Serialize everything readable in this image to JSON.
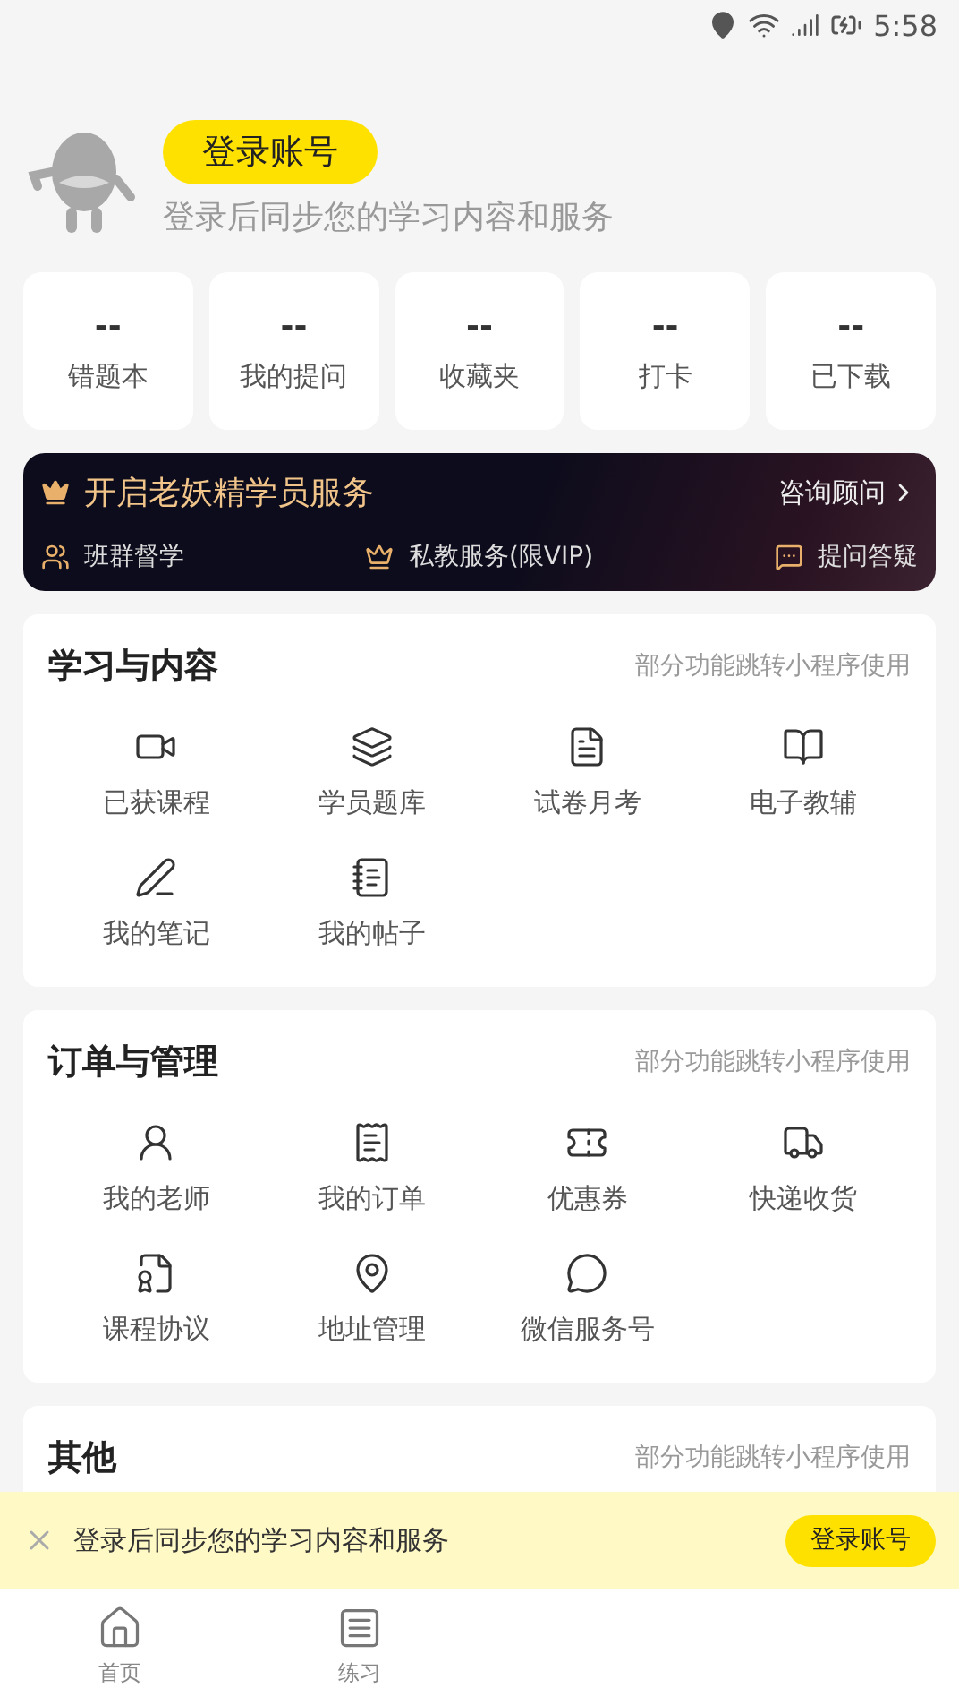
{
  "status_bar": {
    "time": "5:58"
  },
  "profile": {
    "login_button": "登录账号",
    "subtitle": "登录后同步您的学习内容和服务"
  },
  "stats": [
    {
      "value": "--",
      "label": "错题本"
    },
    {
      "value": "--",
      "label": "我的提问"
    },
    {
      "value": "--",
      "label": "收藏夹"
    },
    {
      "value": "--",
      "label": "打卡"
    },
    {
      "value": "--",
      "label": "已下载"
    }
  ],
  "vip_banner": {
    "title": "开启老妖精学员服务",
    "link": "咨询顾问",
    "features": [
      {
        "kind": "group",
        "label": "班群督学"
      },
      {
        "kind": "crown",
        "label": "私教服务(限VIP)"
      },
      {
        "kind": "chat",
        "label": "提问答疑"
      }
    ]
  },
  "sections": [
    {
      "title": "学习与内容",
      "note": "部分功能跳转小程序使用",
      "items": [
        {
          "kind": "video",
          "label": "已获课程"
        },
        {
          "kind": "bank",
          "label": "学员题库"
        },
        {
          "kind": "paper",
          "label": "试卷月考"
        },
        {
          "kind": "ebook",
          "label": "电子教辅"
        },
        {
          "kind": "pen",
          "label": "我的笔记"
        },
        {
          "kind": "post",
          "label": "我的帖子"
        }
      ]
    },
    {
      "title": "订单与管理",
      "note": "部分功能跳转小程序使用",
      "items": [
        {
          "kind": "teacher",
          "label": "我的老师"
        },
        {
          "kind": "order",
          "label": "我的订单"
        },
        {
          "kind": "coupon",
          "label": "优惠券"
        },
        {
          "kind": "truck",
          "label": "快递收货"
        },
        {
          "kind": "agreement",
          "label": "课程协议"
        },
        {
          "kind": "address",
          "label": "地址管理"
        },
        {
          "kind": "wechat",
          "label": "微信服务号"
        }
      ]
    },
    {
      "title": "其他",
      "note": "部分功能跳转小程序使用"
    }
  ],
  "login_prompt": {
    "message": "登录后同步您的学习内容和服务",
    "button": "登录账号"
  },
  "bottom_nav": [
    {
      "kind": "home",
      "label": "首页",
      "selected": false
    },
    {
      "kind": "practice",
      "label": "练习",
      "selected": false
    }
  ]
}
